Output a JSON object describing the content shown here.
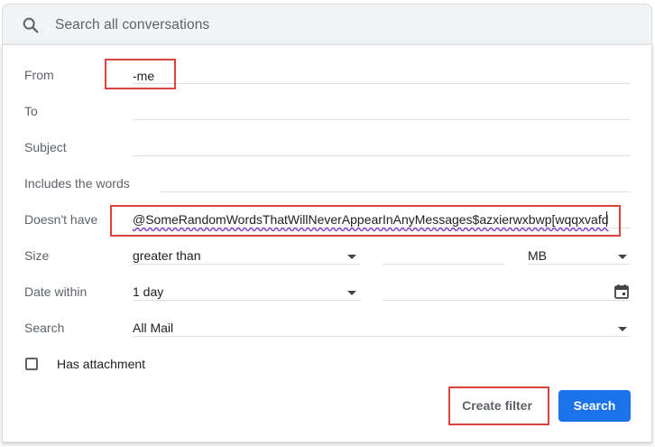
{
  "search": {
    "placeholder": "Search all conversations",
    "icon": "search-icon"
  },
  "form": {
    "from": {
      "label": "From",
      "value": "-me"
    },
    "to": {
      "label": "To",
      "value": ""
    },
    "subject": {
      "label": "Subject",
      "value": ""
    },
    "includes": {
      "label": "Includes the words",
      "value": ""
    },
    "doesnt_have": {
      "label": "Doesn't have",
      "value": "@SomeRandomWordsThatWillNeverAppearInAnyMessages$azxierwxbwp[wqqxvafd"
    },
    "size": {
      "label": "Size",
      "operator": "greater than",
      "value": "",
      "unit": "MB"
    },
    "date_within": {
      "label": "Date within",
      "value": "1 day",
      "date": "",
      "icon": "calendar-icon"
    },
    "search_in": {
      "label": "Search",
      "value": "All Mail"
    },
    "has_attachment": {
      "label": "Has attachment",
      "checked": false
    }
  },
  "actions": {
    "create_filter": "Create filter",
    "search": "Search"
  },
  "colors": {
    "primary": "#1a73e8",
    "highlight_box": "#d9443d",
    "label": "#5f6368"
  }
}
